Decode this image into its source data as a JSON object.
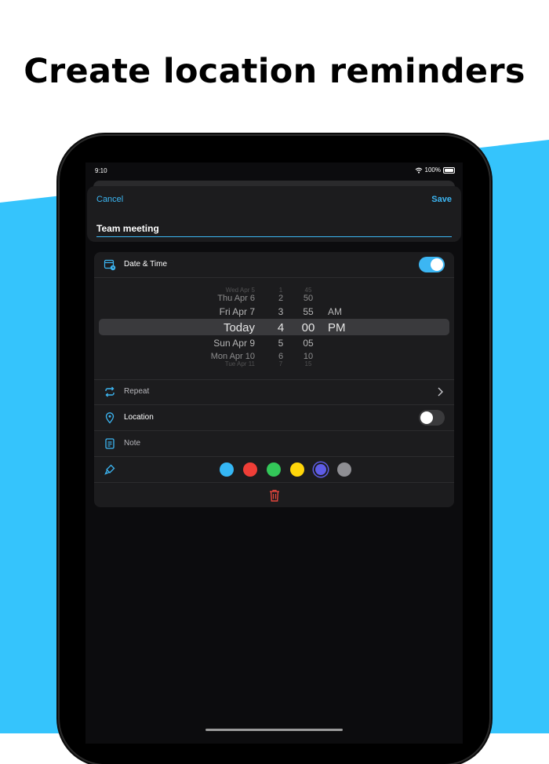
{
  "headline": "Create location reminders",
  "colors": {
    "accent": "#3cb6f3",
    "background_blue": "#35c4fc",
    "delete_red": "#e5463d"
  },
  "status_bar": {
    "time": "9:10",
    "battery": "100%",
    "icons": [
      "wifi-icon",
      "battery-icon"
    ]
  },
  "nav": {
    "cancel_label": "Cancel",
    "save_label": "Save"
  },
  "title_field": {
    "value": "Team meeting"
  },
  "date_time": {
    "label": "Date & Time",
    "enabled": true,
    "icon": "calendar-clock-icon"
  },
  "picker": {
    "dates": [
      "Wed Apr 5",
      "Thu Apr 6",
      "Fri Apr 7",
      "Today",
      "Sun Apr 9",
      "Mon Apr 10",
      "Tue Apr 11"
    ],
    "hours": [
      "1",
      "2",
      "3",
      "4",
      "5",
      "6",
      "7"
    ],
    "minutes": [
      "45",
      "50",
      "55",
      "00",
      "05",
      "10",
      "15"
    ],
    "periods": [
      "AM",
      "PM"
    ],
    "selected": {
      "date": "Today",
      "hour": "4",
      "minute": "00",
      "period": "PM"
    }
  },
  "repeat": {
    "label": "Repeat",
    "icon": "repeat-icon"
  },
  "location": {
    "label": "Location",
    "enabled": false,
    "icon": "location-pin-icon"
  },
  "note": {
    "label": "Note",
    "icon": "note-icon"
  },
  "color_row": {
    "icon": "paint-brush-icon",
    "swatches": [
      "#35b7f5",
      "#ef3e37",
      "#33c759",
      "#ffd60a",
      "#5e5ce6",
      "#8e8e93"
    ],
    "selected_index": 4
  },
  "delete": {
    "icon": "trash-icon"
  }
}
